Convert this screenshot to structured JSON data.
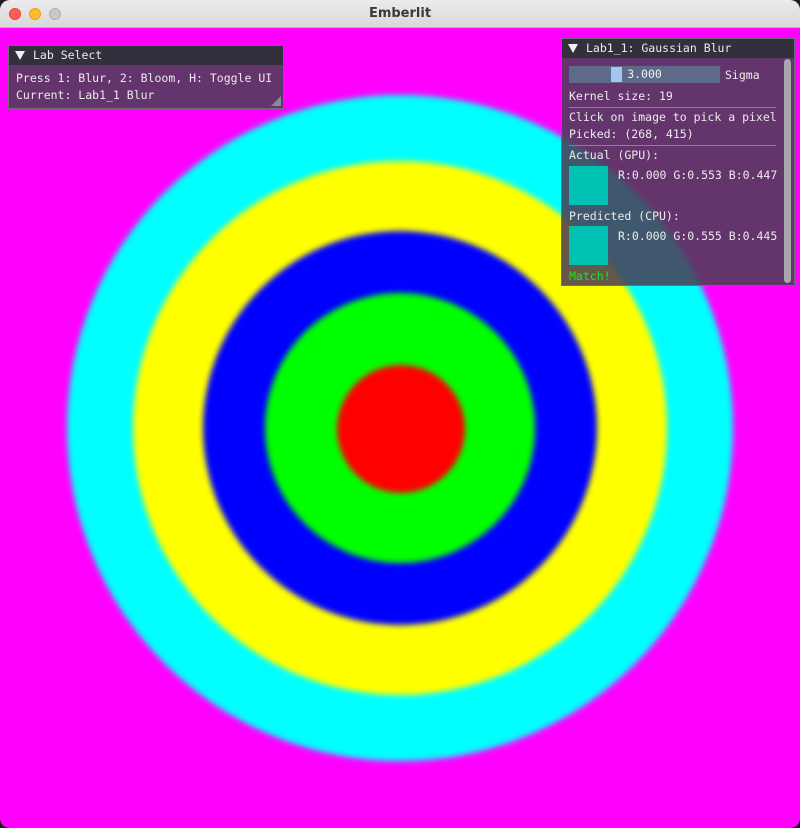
{
  "window": {
    "title": "Emberlit"
  },
  "lab_select": {
    "header": "Lab Select",
    "instructions": "Press 1: Blur, 2: Bloom, H: Toggle UI",
    "current": "Current: Lab1_1 Blur"
  },
  "blur_panel": {
    "header": "Lab1_1: Gaussian Blur",
    "sigma_value": "3.000",
    "sigma_label": "Sigma",
    "kernel_size": "Kernel size: 19",
    "pick_hint": "Click on image to pick a pixel",
    "picked": "Picked: (268, 415)",
    "actual_label": "Actual (GPU):",
    "actual_values": "R:0.000 G:0.553 B:0.447",
    "actual_color": "#00c2b3",
    "predicted_label": "Predicted (CPU):",
    "predicted_values": "R:0.000 G:0.555 B:0.445",
    "predicted_color": "#00c2b3",
    "match": "Match!"
  },
  "scene": {
    "ring_colors": [
      "#00ffff",
      "#ffff00",
      "#0000ff",
      "#00ff00",
      "#ff0000"
    ],
    "background": "#ff00ff"
  }
}
